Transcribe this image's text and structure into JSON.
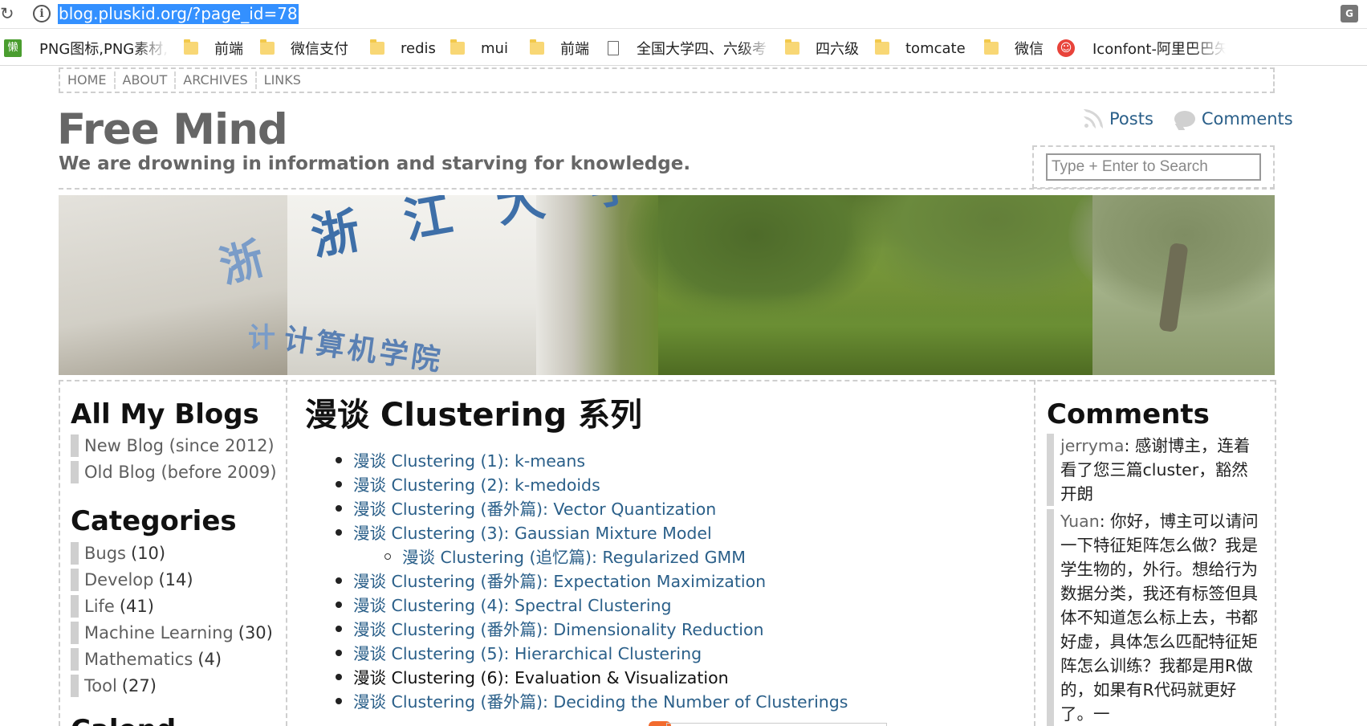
{
  "browser": {
    "url": "blog.pluskid.org/?page_id=78",
    "bookmarks": [
      {
        "icon": "lazy-icon",
        "badge": "懒",
        "label": "PNG图标,PNG素材,|"
      },
      {
        "icon": "folder-icon",
        "label": "前端"
      },
      {
        "icon": "folder-icon",
        "label": "微信支付"
      },
      {
        "icon": "folder-icon",
        "label": "redis"
      },
      {
        "icon": "folder-icon",
        "label": "mui"
      },
      {
        "icon": "folder-icon",
        "label": "前端"
      },
      {
        "icon": "page-icon",
        "label": "全国大学四、六级考"
      },
      {
        "icon": "folder-icon",
        "label": "四六级"
      },
      {
        "icon": "folder-icon",
        "label": "tomcate"
      },
      {
        "icon": "folder-icon",
        "label": "微信"
      },
      {
        "icon": "iconfont-icon",
        "label": "Iconfont-阿里巴巴矢"
      }
    ]
  },
  "nav": [
    "HOME",
    "ABOUT",
    "ARCHIVES",
    "LINKS"
  ],
  "site": {
    "title": "Free Mind",
    "tagline": "We are drowning in information and starving for knowledge."
  },
  "feeds": {
    "posts": "Posts",
    "comments": "Comments"
  },
  "search": {
    "placeholder": "Type + Enter to Search"
  },
  "banner": {
    "text_top": "浙 江 大 学",
    "text_bottom": "计算机学院"
  },
  "sidebar_left": {
    "blogs_title": "All My Blogs",
    "blogs": [
      "New Blog (since 2012)",
      "Old Blog (before 2009)"
    ],
    "categories_title": "Categories",
    "categories": [
      {
        "name": "Bugs",
        "count": "(10)"
      },
      {
        "name": "Develop",
        "count": "(14)"
      },
      {
        "name": "Life",
        "count": "(41)"
      },
      {
        "name": "Machine Learning",
        "count": "(30)"
      },
      {
        "name": "Mathematics",
        "count": "(4)"
      },
      {
        "name": "Tool",
        "count": "(27)"
      }
    ],
    "next_heading_partial": "Calend"
  },
  "main": {
    "title": "漫谈 Clustering 系列",
    "posts": [
      {
        "text": "漫谈 Clustering (1): k-means",
        "level": 1,
        "link": true
      },
      {
        "text": "漫谈 Clustering (2): k-medoids",
        "level": 1,
        "link": true
      },
      {
        "text": "漫谈 Clustering (番外篇): Vector Quantization",
        "level": 1,
        "link": true
      },
      {
        "text": "漫谈 Clustering (3): Gaussian Mixture Model",
        "level": 1,
        "link": true
      },
      {
        "text": "漫谈 Clustering (追忆篇): Regularized GMM",
        "level": 2,
        "link": true
      },
      {
        "text": "漫谈 Clustering (番外篇): Expectation Maximization",
        "level": 1,
        "link": true
      },
      {
        "text": "漫谈 Clustering (4): Spectral Clustering",
        "level": 1,
        "link": true
      },
      {
        "text": "漫谈 Clustering (番外篇): Dimensionality Reduction",
        "level": 1,
        "link": true
      },
      {
        "text": "漫谈 Clustering (5): Hierarchical Clustering",
        "level": 1,
        "link": true
      },
      {
        "text": "漫谈 Clustering (6): Evaluation & Visualization",
        "level": 1,
        "link": false
      },
      {
        "text": "漫谈 Clustering (番外篇): Deciding the Number of Clusterings",
        "level": 1,
        "link": true
      }
    ]
  },
  "sidebar_right": {
    "title": "Comments",
    "comments": [
      {
        "author": "jerryma",
        "text": ": 感谢博主，连着看了您三篇cluster，豁然开朗"
      },
      {
        "author": "Yuan",
        "text": ": 你好，博主可以请问一下特征矩阵怎么做？我是学生物的，外行。想给行为数据分类，我还有标签但具体不知道怎么标上去，书都好虚，具体怎么匹配特征矩阵怎么训练？我都是用R做的，如果有R代码就更好了。一"
      }
    ]
  }
}
